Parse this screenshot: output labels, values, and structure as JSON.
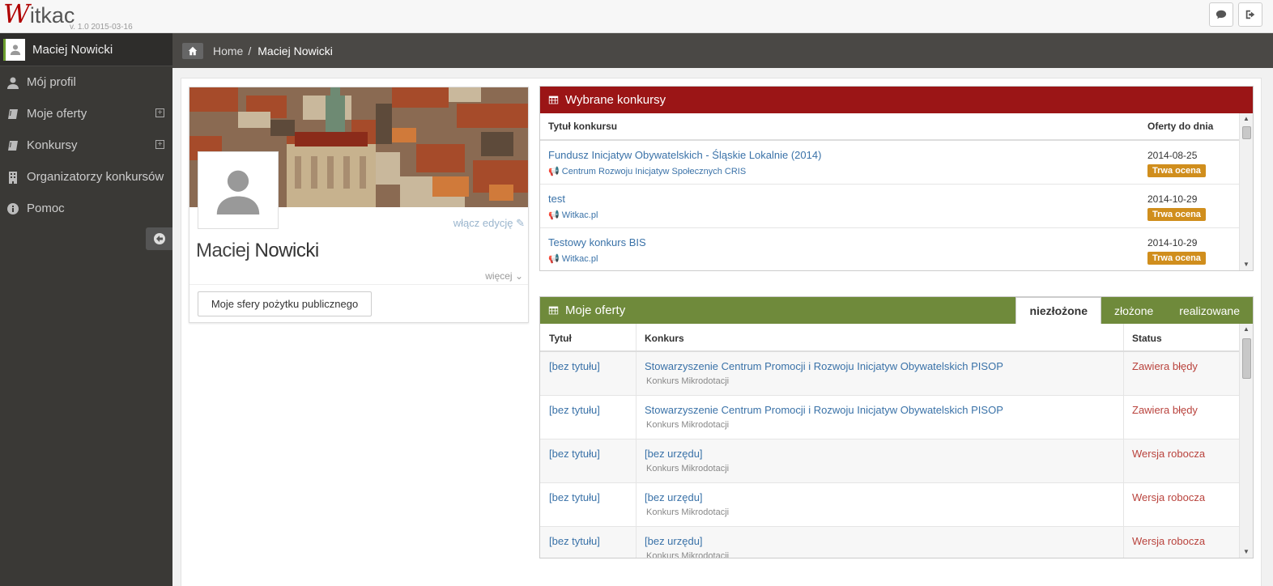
{
  "app": {
    "logo_first": "W",
    "logo_rest": "itkac",
    "version": "v. 1.0 2015-03-16"
  },
  "topbar": {
    "chat_icon": "comment-icon",
    "logout_icon": "sign-out-icon"
  },
  "sidebar": {
    "user_name": "Maciej Nowicki",
    "items": [
      {
        "label": "Mój profil",
        "icon": "user-icon",
        "expandable": false
      },
      {
        "label": "Moje oferty",
        "icon": "book-icon",
        "expandable": true
      },
      {
        "label": "Konkursy",
        "icon": "book-icon",
        "expandable": true
      },
      {
        "label": "Organizatorzy konkursów",
        "icon": "building-icon",
        "expandable": false
      },
      {
        "label": "Pomoc",
        "icon": "info-icon",
        "expandable": false
      }
    ],
    "expand_symbol": "+"
  },
  "breadcrumb": {
    "home": "Home",
    "separator": "/",
    "current": "Maciej Nowicki"
  },
  "profile": {
    "edit_label": "włącz edycję",
    "first_name": "Maciej",
    "last_name": "Nowicki",
    "more_label": "więcej",
    "spheres_button": "Moje sfery pożytku publicznego"
  },
  "selected_contests": {
    "title": "Wybrane konkursy",
    "color": "#9b1516",
    "col_title": "Tytuł konkursu",
    "col_deadline": "Oferty do dnia",
    "rows": [
      {
        "title": "Fundusz Inicjatyw Obywatelskich - Śląskie Lokalnie (2014)",
        "organizer": "Centrum Rozwoju Inicjatyw Społecznych CRIS",
        "date": "2014-08-25",
        "status": "Trwa ocena"
      },
      {
        "title": "test",
        "organizer": "Witkac.pl",
        "date": "2014-10-29",
        "status": "Trwa ocena"
      },
      {
        "title": "Testowy konkurs BIS",
        "organizer": "Witkac.pl",
        "date": "2014-10-29",
        "status": "Trwa ocena"
      }
    ]
  },
  "my_offers": {
    "title": "Moje oferty",
    "color": "#6f8a3b",
    "tabs": [
      {
        "label": "niezłożone",
        "active": true
      },
      {
        "label": "złożone",
        "active": false
      },
      {
        "label": "realizowane",
        "active": false
      }
    ],
    "col_title": "Tytuł",
    "col_contest": "Konkurs",
    "col_status": "Status",
    "rows": [
      {
        "title": "[bez tytułu]",
        "contest": "Stowarzyszenie Centrum Promocji i Rozwoju Inicjatyw Obywatelskich PISOP",
        "sub": "Konkurs Mikrodotacji",
        "status": "Zawiera błędy"
      },
      {
        "title": "[bez tytułu]",
        "contest": "Stowarzyszenie Centrum Promocji i Rozwoju Inicjatyw Obywatelskich PISOP",
        "sub": "Konkurs Mikrodotacji",
        "status": "Zawiera błędy"
      },
      {
        "title": "[bez tytułu]",
        "contest": "[bez urzędu]",
        "sub": "Konkurs Mikrodotacji",
        "status": "Wersja robocza"
      },
      {
        "title": "[bez tytułu]",
        "contest": "[bez urzędu]",
        "sub": "Konkurs Mikrodotacji",
        "status": "Wersja robocza"
      },
      {
        "title": "[bez tytułu]",
        "contest": "[bez urzędu]",
        "sub": "Konkurs Mikrodotacji",
        "status": "Wersja robocza"
      }
    ]
  }
}
